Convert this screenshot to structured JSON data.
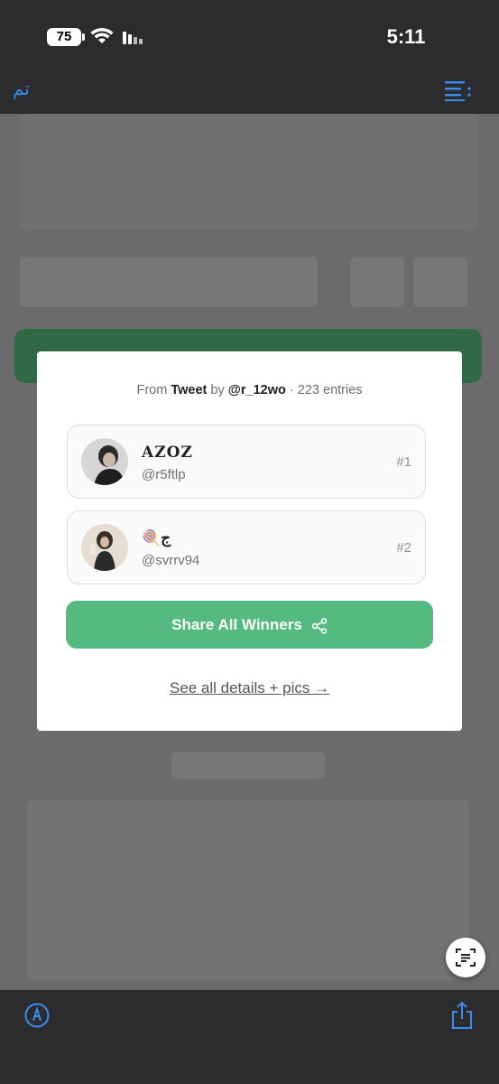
{
  "status_bar": {
    "time": "5:11",
    "battery": "75"
  },
  "toolbar": {
    "done_label": "تم",
    "list_icon": "list-bullet-icon"
  },
  "modal": {
    "prefix": "From",
    "source": "Tweet",
    "by": "by",
    "author": "@r_12wo",
    "entries": "· 223 entries",
    "winners": [
      {
        "name": "AZOZ",
        "handle": "@r5ftlp",
        "rank": "#1"
      },
      {
        "name": "🍭ج",
        "handle": "@svrrv94",
        "rank": "#2"
      }
    ],
    "share_label": "Share All Winners",
    "details_label": "See all details + pics →"
  },
  "colors": {
    "accent_green": "#55ba80",
    "ios_blue": "#3b8cf0"
  },
  "icons": {
    "share": "share-nodes-icon",
    "markup": "markup-pen-icon",
    "share_sheet": "share-sheet-icon",
    "text_scan": "live-text-icon"
  }
}
